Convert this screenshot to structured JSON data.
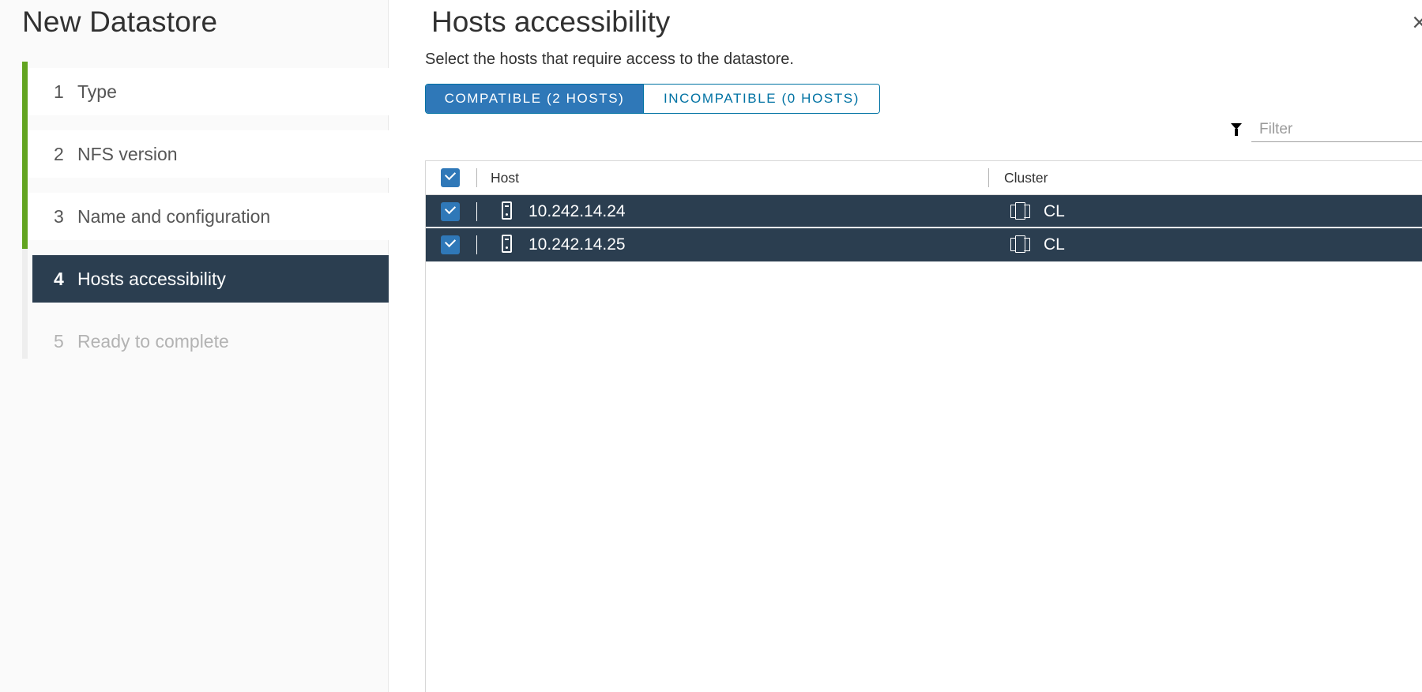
{
  "wizard": {
    "title": "New Datastore",
    "steps": [
      {
        "num": "1",
        "label": "Type",
        "state": "done"
      },
      {
        "num": "2",
        "label": "NFS version",
        "state": "done"
      },
      {
        "num": "3",
        "label": "Name and configuration",
        "state": "done"
      },
      {
        "num": "4",
        "label": "Hosts accessibility",
        "state": "current"
      },
      {
        "num": "5",
        "label": "Ready to complete",
        "state": "upcoming"
      }
    ]
  },
  "content": {
    "title": "Hosts accessibility",
    "close_glyph": "×",
    "description": "Select the hosts that require access to the datastore.",
    "toggle": {
      "compatible_label": "COMPATIBLE (2 HOSTS)",
      "incompatible_label": "INCOMPATIBLE (0 HOSTS)",
      "selected": "compatible"
    },
    "filter": {
      "placeholder": "Filter",
      "value": ""
    },
    "grid": {
      "columns": [
        "Host",
        "Cluster"
      ],
      "all_selected": true,
      "rows": [
        {
          "host": "10.242.14.24",
          "cluster": "CL",
          "selected": true
        },
        {
          "host": "10.242.14.25",
          "cluster": "CL",
          "selected": true
        }
      ]
    }
  },
  "colors": {
    "step_done_bar": "#62a420",
    "current_step_bg": "#2b3e50",
    "accent_blue": "#0072a3",
    "checkbox_blue": "#2f78b8",
    "selected_row_bg": "#2b3e50"
  },
  "icons": {
    "filter": "filter-funnel-icon",
    "host": "host-server-icon",
    "cluster": "cluster-icon",
    "checkbox": "checkbox-checked-icon",
    "close": "close-icon"
  }
}
